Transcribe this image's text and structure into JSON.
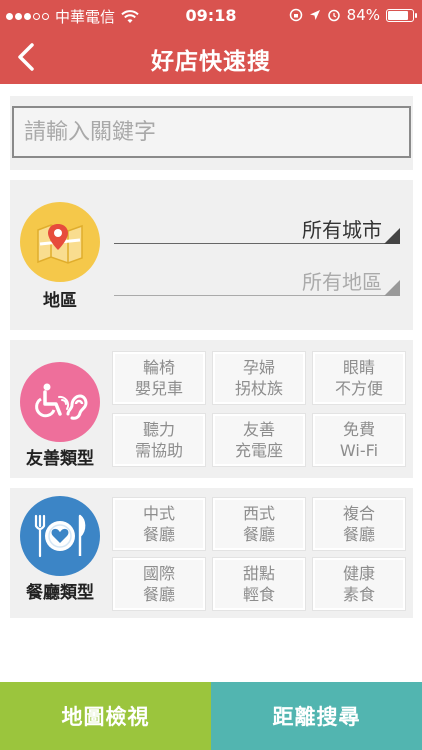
{
  "status_bar": {
    "carrier": "中華電信",
    "time": "09:18",
    "battery": "84%",
    "battery_level": 0.84,
    "icons": [
      "signal-dots-icon",
      "wifi-icon",
      "rotation-lock-icon",
      "location-arrow-icon",
      "alarm-icon",
      "battery-icon"
    ]
  },
  "header": {
    "title": "好店快速搜",
    "back_icon": "chevron-left-icon"
  },
  "search": {
    "placeholder": "請輸入關鍵字",
    "value": ""
  },
  "region": {
    "label": "地區",
    "icon": "map-pin-icon",
    "city": "所有城市",
    "district": "所有地區"
  },
  "friendly": {
    "label": "友善類型",
    "icon": "accessibility-icon",
    "options": [
      [
        "輪椅",
        "嬰兒車"
      ],
      [
        "孕婦",
        "拐杖族"
      ],
      [
        "眼睛",
        "不方便"
      ],
      [
        "聽力",
        "需協助"
      ],
      [
        "友善",
        "充電座"
      ],
      [
        "免費",
        "Wi-Fi"
      ]
    ]
  },
  "restaurant": {
    "label": "餐廳類型",
    "icon": "plate-utensils-icon",
    "options": [
      [
        "中式",
        "餐廳"
      ],
      [
        "西式",
        "餐廳"
      ],
      [
        "複合",
        "餐廳"
      ],
      [
        "國際",
        "餐廳"
      ],
      [
        "甜點",
        "輕食"
      ],
      [
        "健康",
        "素食"
      ]
    ]
  },
  "bottom": {
    "map_view": "地圖檢視",
    "distance_search": "距離搜尋"
  },
  "colors": {
    "header_red": "#d9534f",
    "region_yellow": "#f5c84a",
    "friendly_pink": "#ee6f9b",
    "restaurant_blue": "#3c85c6",
    "map_green": "#9bc53d",
    "distance_teal": "#52b5b0"
  }
}
